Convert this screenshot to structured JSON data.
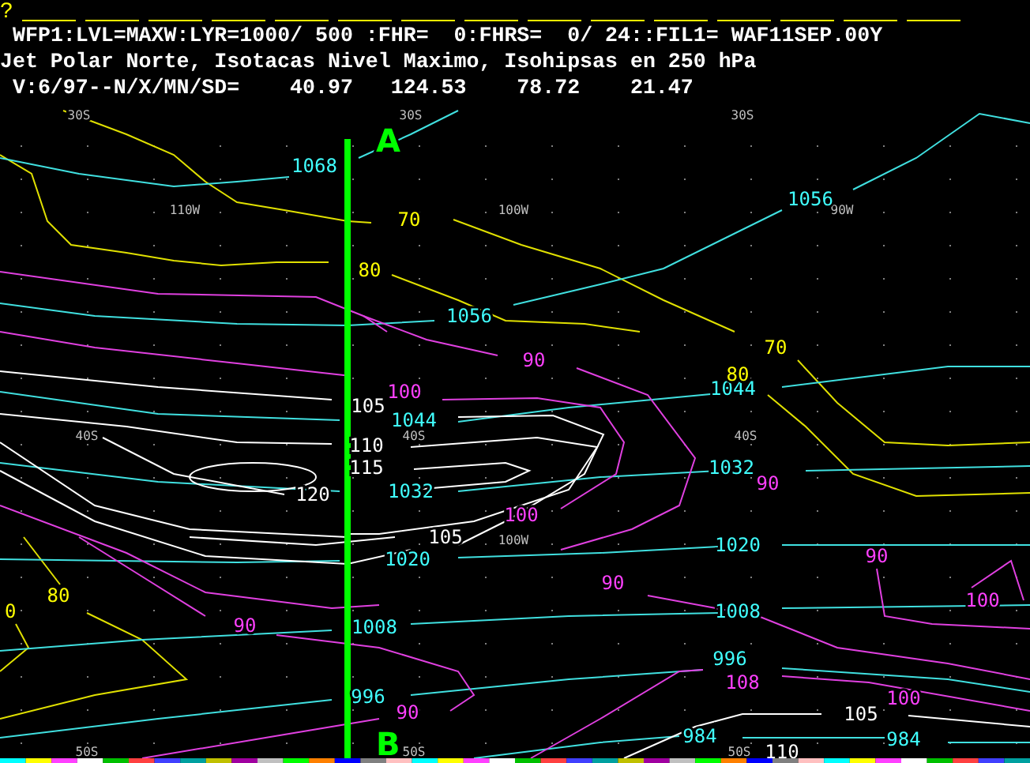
{
  "prompt": "?",
  "header": [
    "WFP1:LVL=MAXW:LYR=1000/ 500 :FHR=  0:FHRS=  0/ 24::FIL1= WAF11SEP.00Y",
    "Jet Polar Norte, Isotacas Nivel Maximo, Isohipsas en 250 hPa",
    " V:6/97--N/X/MN/SD=    40.97   124.53    78.72    21.47"
  ],
  "cross_section": {
    "start_label": "A",
    "end_label": "B"
  },
  "map_labels": [
    {
      "text": "30S",
      "kind": "grid"
    },
    {
      "text": "30S",
      "kind": "grid"
    },
    {
      "text": "30S",
      "kind": "grid"
    },
    {
      "text": "110W",
      "kind": "grid"
    },
    {
      "text": "100W",
      "kind": "grid"
    },
    {
      "text": "90W",
      "kind": "grid"
    },
    {
      "text": "40S",
      "kind": "grid"
    },
    {
      "text": "40S",
      "kind": "grid"
    },
    {
      "text": "40S",
      "kind": "grid"
    },
    {
      "text": "100W",
      "kind": "grid"
    },
    {
      "text": "50S",
      "kind": "grid"
    },
    {
      "text": "50S",
      "kind": "grid"
    },
    {
      "text": "50S",
      "kind": "grid"
    },
    {
      "text": "1068",
      "kind": "height"
    },
    {
      "text": "1056",
      "kind": "height"
    },
    {
      "text": "1056",
      "kind": "height"
    },
    {
      "text": "1044",
      "kind": "height"
    },
    {
      "text": "1044",
      "kind": "height"
    },
    {
      "text": "1032",
      "kind": "height"
    },
    {
      "text": "1032",
      "kind": "height"
    },
    {
      "text": "1020",
      "kind": "height"
    },
    {
      "text": "1020",
      "kind": "height"
    },
    {
      "text": "1008",
      "kind": "height"
    },
    {
      "text": "1008",
      "kind": "height"
    },
    {
      "text": "996",
      "kind": "height"
    },
    {
      "text": "996",
      "kind": "height"
    },
    {
      "text": "984",
      "kind": "height"
    },
    {
      "text": "984",
      "kind": "height"
    },
    {
      "text": "70",
      "kind": "isotach",
      "color": "#ffff00"
    },
    {
      "text": "80",
      "kind": "isotach",
      "color": "#ffff00"
    },
    {
      "text": "70",
      "kind": "isotach",
      "color": "#ffff00"
    },
    {
      "text": "80",
      "kind": "isotach",
      "color": "#ffff00"
    },
    {
      "text": "80",
      "kind": "isotach",
      "color": "#ffff00"
    },
    {
      "text": "0",
      "kind": "isotach",
      "color": "#ffff00"
    },
    {
      "text": "90",
      "kind": "isotach",
      "color": "#ff40ff"
    },
    {
      "text": "100",
      "kind": "isotach",
      "color": "#ff40ff"
    },
    {
      "text": "90",
      "kind": "isotach",
      "color": "#ff40ff"
    },
    {
      "text": "100",
      "kind": "isotach",
      "color": "#ff40ff"
    },
    {
      "text": "90",
      "kind": "isotach",
      "color": "#ff40ff"
    },
    {
      "text": "90",
      "kind": "isotach",
      "color": "#ff40ff"
    },
    {
      "text": "100",
      "kind": "isotach",
      "color": "#ff40ff"
    },
    {
      "text": "90",
      "kind": "isotach",
      "color": "#ff40ff"
    },
    {
      "text": "90",
      "kind": "isotach",
      "color": "#ff40ff"
    },
    {
      "text": "108",
      "kind": "isotach",
      "color": "#ff40ff"
    },
    {
      "text": "100",
      "kind": "isotach",
      "color": "#ff40ff"
    },
    {
      "text": "105",
      "kind": "isotach",
      "color": "#ffffff"
    },
    {
      "text": "110",
      "kind": "isotach",
      "color": "#ffffff"
    },
    {
      "text": "115",
      "kind": "isotach",
      "color": "#ffffff"
    },
    {
      "text": "120",
      "kind": "isotach",
      "color": "#ffffff"
    },
    {
      "text": "105",
      "kind": "isotach",
      "color": "#ffffff"
    },
    {
      "text": "105",
      "kind": "isotach",
      "color": "#ffffff"
    },
    {
      "text": "110",
      "kind": "isotach",
      "color": "#ffffff"
    }
  ]
}
